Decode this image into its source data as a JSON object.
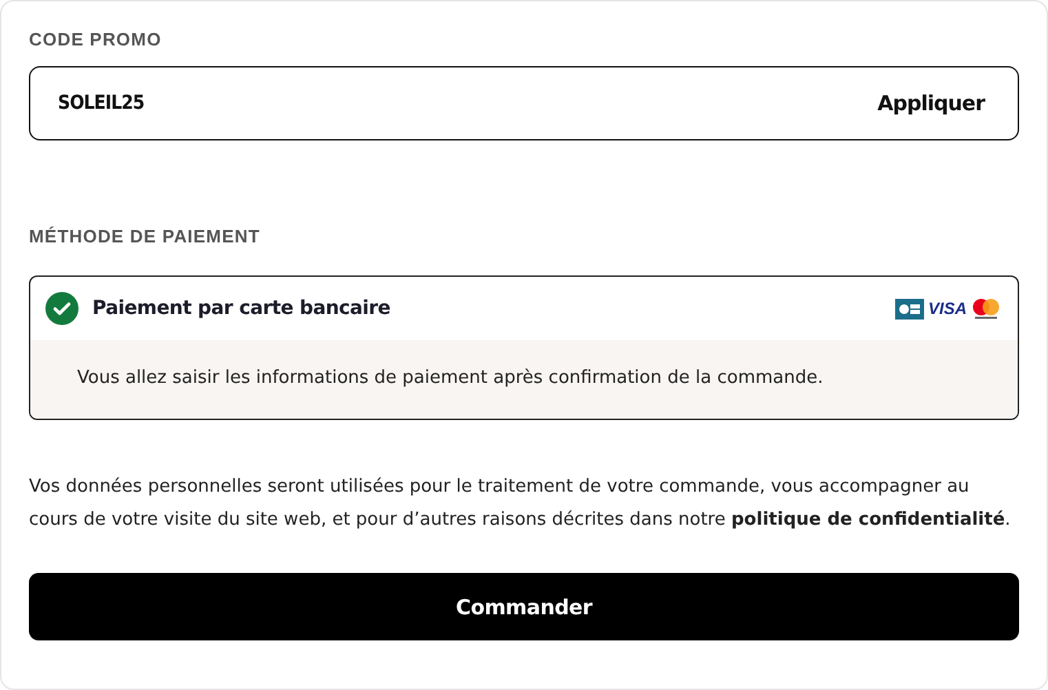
{
  "promo": {
    "heading": "CODE PROMO",
    "value": "SOLEIL25",
    "apply": "Appliquer"
  },
  "payment": {
    "heading": "MÉTHODE DE PAIEMENT",
    "methods": [
      {
        "label": "Paiement par carte bancaire",
        "selected": true,
        "brand_text": "VISA",
        "description": "Vous allez saisir les informations de paiement après confirmation de la commande."
      }
    ]
  },
  "privacy": "Vos données personnelles seront utilisées pour le traitement de votre commande, vous accompagner au cours de votre visite du site web, et pour d’autres raisons décrites dans notre **politique de confidentialité**.",
  "submit": "Commander"
}
